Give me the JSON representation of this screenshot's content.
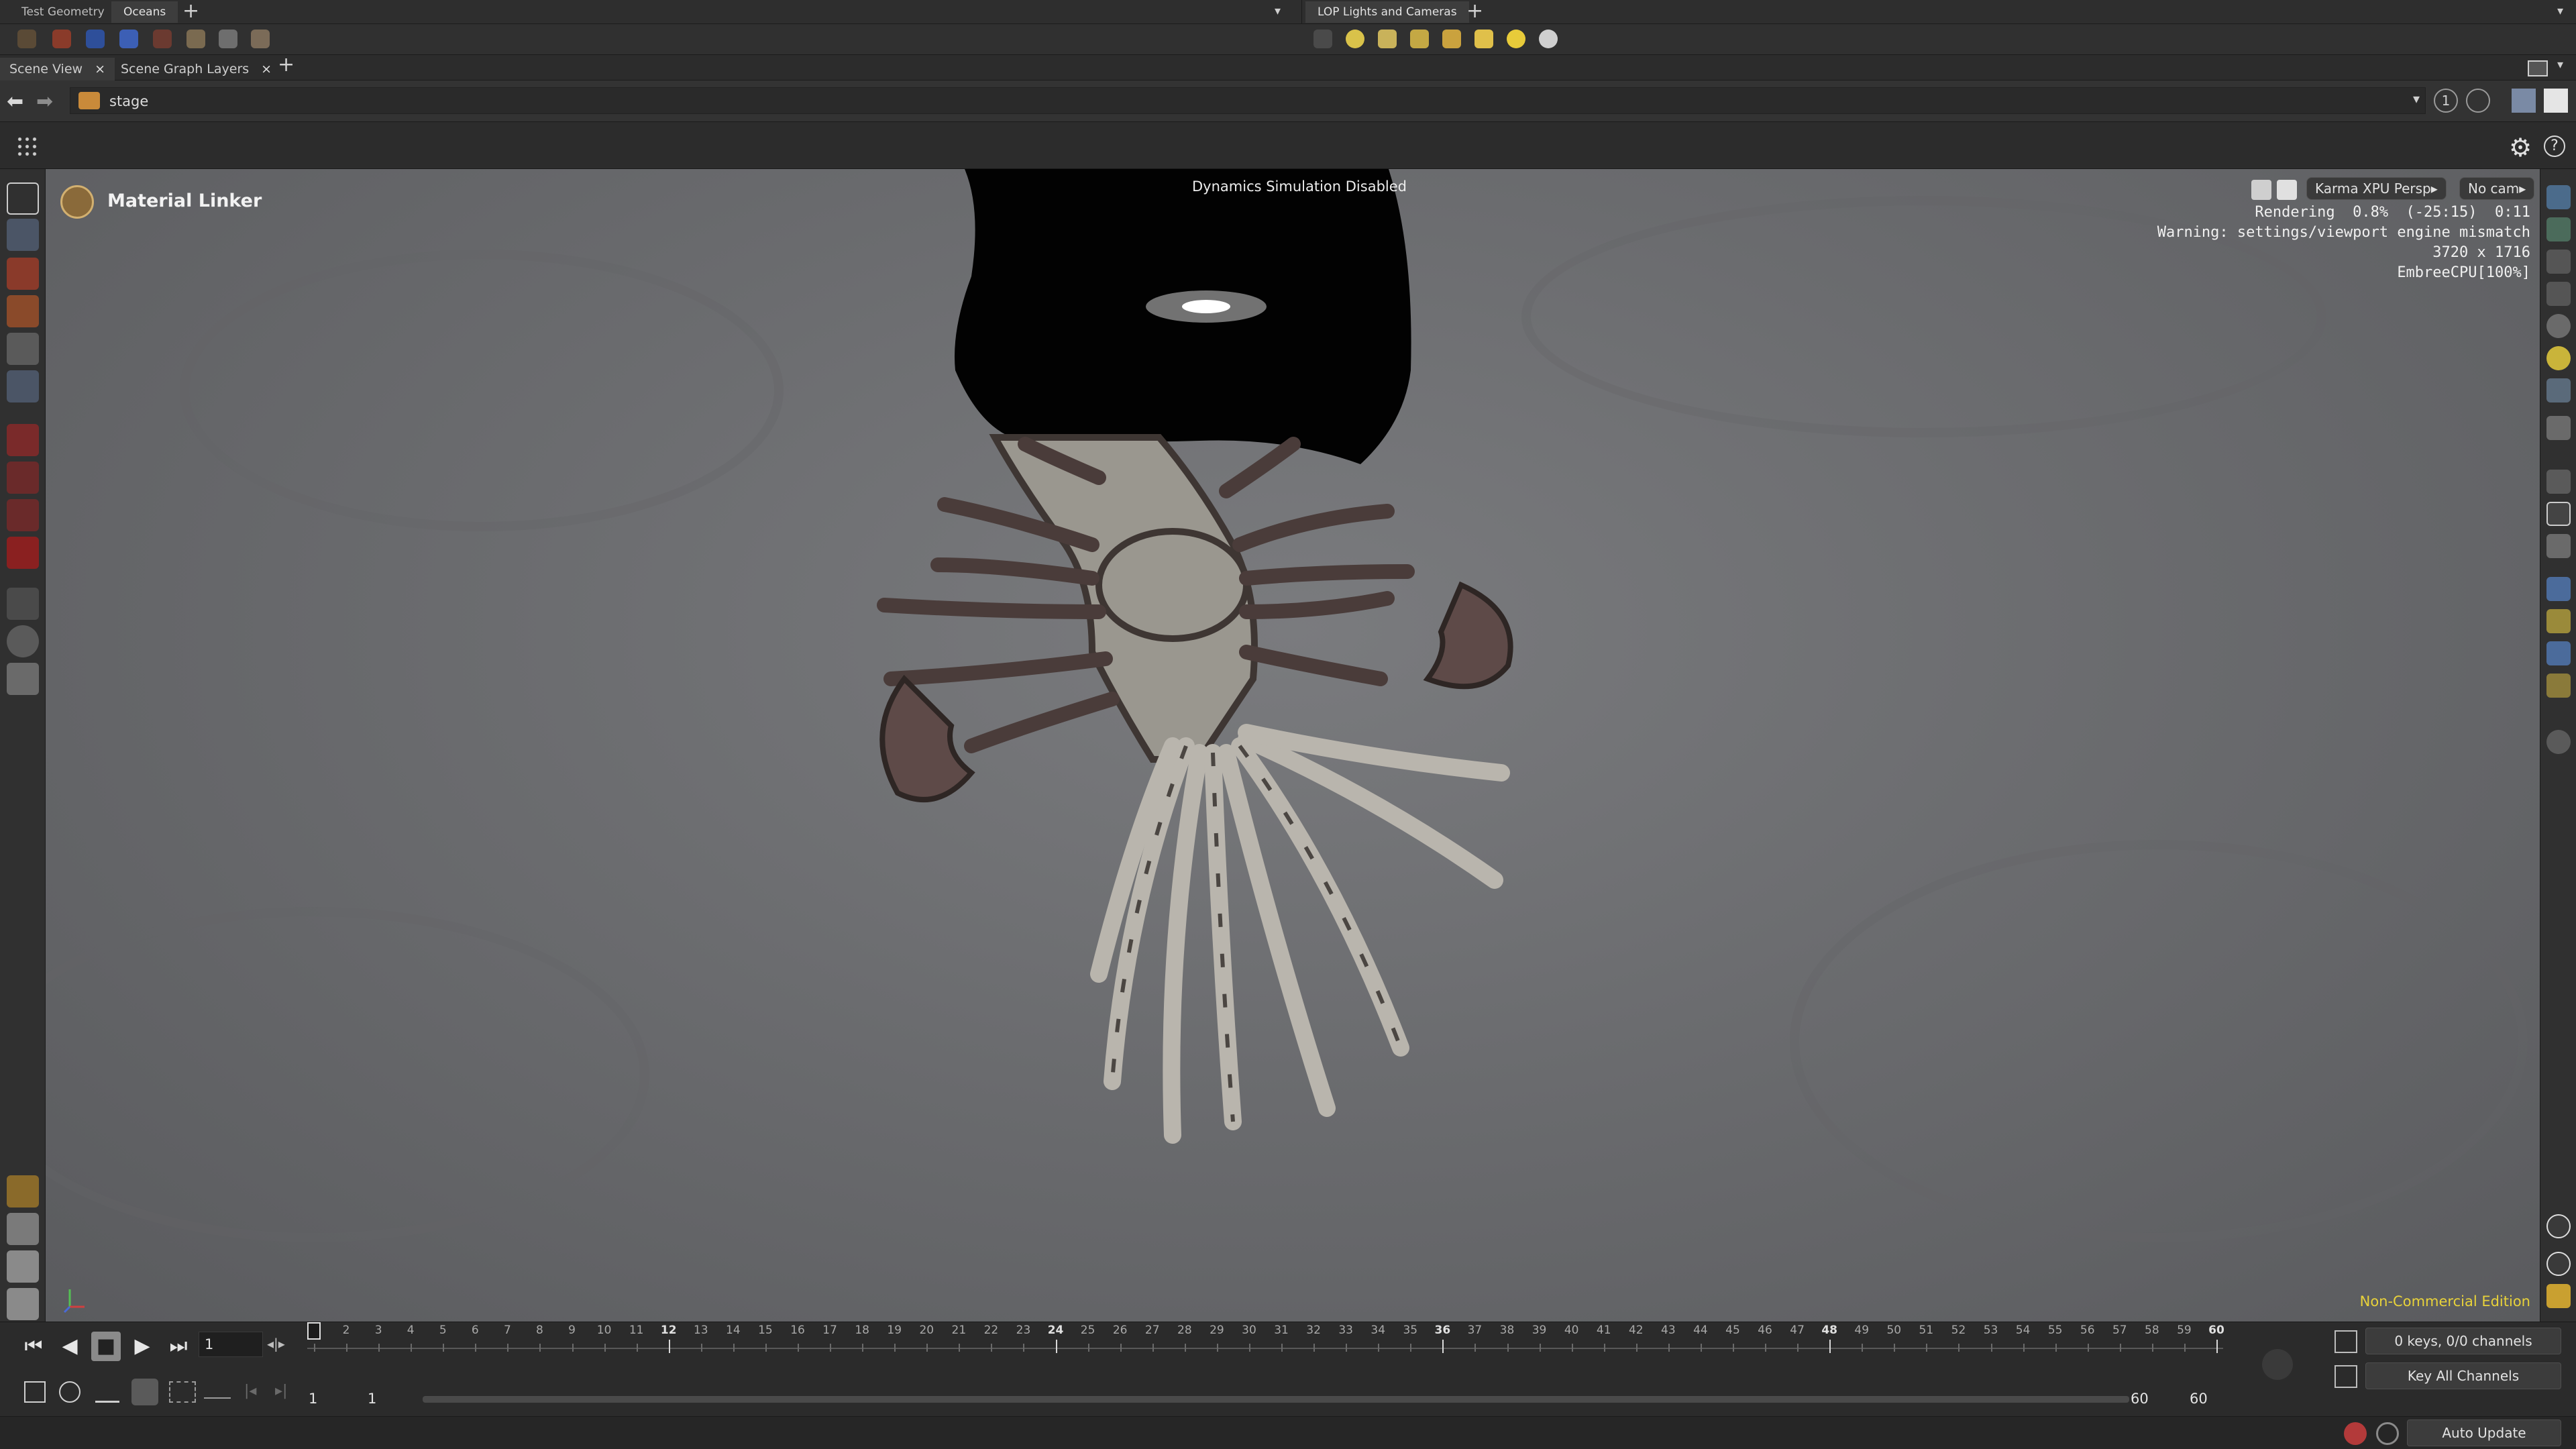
{
  "shelf": {
    "left_tabs": [
      "Test Geometry",
      "Oceans"
    ],
    "right_tabs": [
      "LOP Lights and Cameras"
    ]
  },
  "pane_tabs": [
    {
      "label": "Scene View",
      "close": "×"
    },
    {
      "label": "Scene Graph Layers",
      "close": "×"
    }
  ],
  "path": {
    "current": "stage"
  },
  "viewport": {
    "tool_name": "Material Linker",
    "sim_status": "Dynamics Simulation Disabled",
    "renderer_button": "Karma XPU  Persp",
    "camera_button": "No cam",
    "render_info": [
      "Rendering  0.8%  (-25:15)  0:11",
      "Warning: settings/viewport engine mismatch",
      "3720 x 1716",
      "EmbreeCPU[100%]"
    ],
    "edition": "Non-Commercial Edition"
  },
  "timeline": {
    "current_frame": "1",
    "ticks": [
      "1",
      "2",
      "3",
      "4",
      "5",
      "6",
      "7",
      "8",
      "9",
      "10",
      "11",
      "12",
      "13",
      "14",
      "15",
      "16",
      "17",
      "18",
      "19",
      "20",
      "21",
      "22",
      "23",
      "24",
      "25",
      "26",
      "27",
      "28",
      "29",
      "30",
      "31",
      "32",
      "33",
      "34",
      "35",
      "36",
      "37",
      "38",
      "39",
      "40",
      "41",
      "42",
      "43",
      "44",
      "45",
      "46",
      "47",
      "48",
      "49",
      "50",
      "51",
      "52",
      "53",
      "54",
      "55",
      "56",
      "57",
      "58",
      "59",
      "60"
    ],
    "major_ticks": [
      "12",
      "24",
      "36",
      "48",
      "60"
    ],
    "range_start": "1",
    "range_start2": "1",
    "range_end": "60",
    "range_end2": "60",
    "keys_label": "0 keys, 0/0 channels",
    "key_all_label": "Key All Channels",
    "auto_update": "Auto Update"
  }
}
